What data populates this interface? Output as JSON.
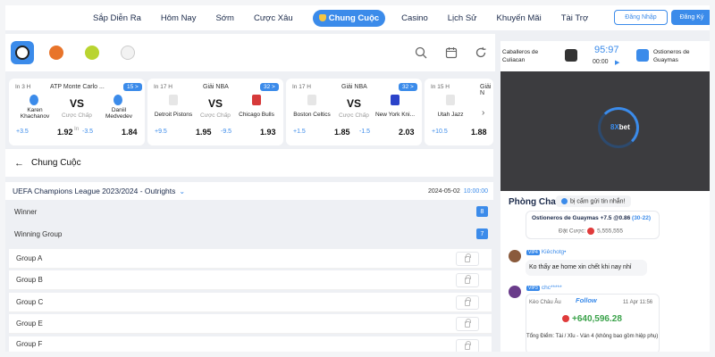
{
  "nav": {
    "items": [
      "Sắp Diễn Ra",
      "Hôm Nay",
      "Sớm",
      "Cược Xâu"
    ],
    "active": "Chung Cuộc",
    "items_after": [
      "Casino",
      "Lịch Sử",
      "Khuyến Mãi",
      "Tài Trợ"
    ],
    "login": "Đăng Nhập",
    "register": "Đăng Ký"
  },
  "sports": [
    "soccer-ball-icon",
    "basketball-icon",
    "tennis-ball-icon",
    "baseball-icon"
  ],
  "cards": [
    {
      "when": "In 3 H",
      "league": "ATP Monte Carlo ...",
      "count": "15 >",
      "team1": "Karen Khachanov",
      "team2": "Daniil Medvedev",
      "hcap": "Cược Chấp",
      "l1": "+3.5",
      "o1": "1.92",
      "l2": "-3.5",
      "o2": "1.84",
      "mid": "In"
    },
    {
      "when": "In 17 H",
      "league": "Giải NBA",
      "count": "32 >",
      "team1": "Detroit Pistons",
      "team2": "Chicago Bulls",
      "hcap": "Cược Chấp",
      "l1": "+9.5",
      "o1": "1.95",
      "l2": "-9.5",
      "o2": "1.93"
    },
    {
      "when": "In 17 H",
      "league": "Giải NBA",
      "count": "32 >",
      "team1": "Boston Celtics",
      "team2": "New York Kni...",
      "hcap": "Cược Chấp",
      "l1": "+1.5",
      "o1": "1.85",
      "l2": "-1.5",
      "o2": "2.03"
    },
    {
      "when": "In 15 H",
      "league": "Giải N",
      "count": "",
      "team1": "Utah Jazz",
      "team2": "",
      "hcap": "",
      "l1": "+10.5",
      "o1": "1.88",
      "l2": "",
      "o2": ""
    }
  ],
  "vs": "VS",
  "section": {
    "title": "Chung Cuộc"
  },
  "league": {
    "name": "UEFA Champions League 2023/2024 - Outrights",
    "date": "2024-05-02",
    "time": "10:00:00"
  },
  "markets": [
    {
      "label": "Winner",
      "count": "8"
    },
    {
      "label": "Winning Group",
      "count": "7"
    }
  ],
  "groups": [
    "Group A",
    "Group B",
    "Group C",
    "Group E",
    "Group F"
  ],
  "live": {
    "home": "Caballeros de Culiacan",
    "away": "Ostioneros de Guaymas",
    "score": "95:97",
    "clock": "00:00"
  },
  "brand": {
    "prefix": "8X",
    "suffix": "bet"
  },
  "chat": {
    "title": "Phòng Chat",
    "note": "bị cấm gửi tin nhắn!",
    "bet_card": {
      "line": "Ostioneros de Guaymas +7.5 @0.86",
      "record": "(30-22)",
      "label": "Đặt Cược:",
      "amount": "5,555,555"
    },
    "msg1": {
      "tag": "VIP4",
      "user": "Kiêchotg•",
      "text": "Ko thấy ae home xin chết khi nay nhỉ"
    },
    "msg2": {
      "tag": "VIP3",
      "user": "chc*****",
      "follow": "Follow",
      "market": "Kèo Châu Âu",
      "time": "11 Apr 11:56",
      "win": "+640,596.28",
      "detail": "Tổng Điểm: Tài / Xỉu - Ván 4 (không bao gồm hiệp phụ)"
    }
  }
}
